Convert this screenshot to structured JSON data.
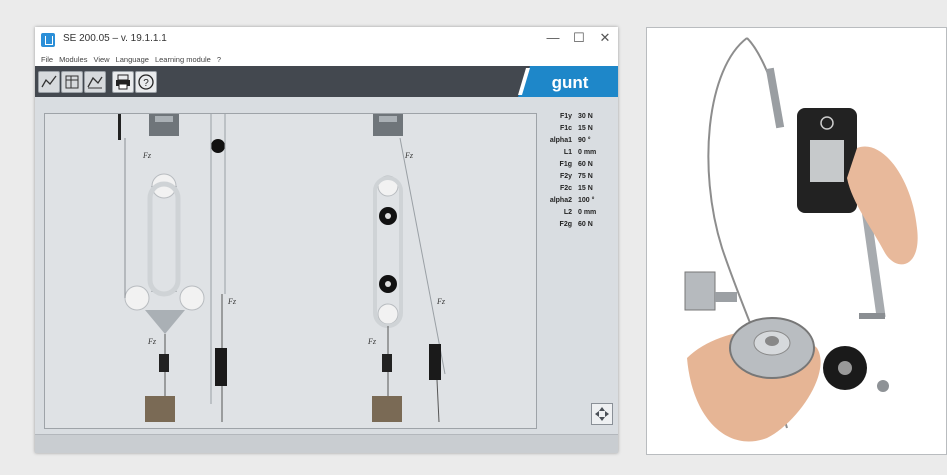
{
  "window": {
    "title": "SE 200.05 – v. 19.1.1.1",
    "controls": [
      "—",
      "☐",
      "✕"
    ]
  },
  "menu": [
    "File",
    "Modules",
    "View",
    "Language",
    "Learning module",
    "?"
  ],
  "toolbar": {
    "logo_text": "gunt"
  },
  "readouts": [
    {
      "label": "F1y",
      "value": "30 N"
    },
    {
      "label": "F1c",
      "value": "15 N"
    },
    {
      "label": "alpha1",
      "value": "90 °"
    },
    {
      "label": "L1",
      "value": "0 mm"
    },
    {
      "label": "F1g",
      "value": "60 N"
    },
    {
      "label": "F2y",
      "value": "75 N"
    },
    {
      "label": "F2c",
      "value": "15 N"
    },
    {
      "label": "alpha2",
      "value": "100 °"
    },
    {
      "label": "L2",
      "value": "0 mm"
    },
    {
      "label": "F2g",
      "value": "60 N"
    }
  ],
  "diagram": {
    "force_labels": [
      "Fz",
      "Fz",
      "Fz",
      "Fz",
      "Fz",
      "Fz"
    ]
  }
}
